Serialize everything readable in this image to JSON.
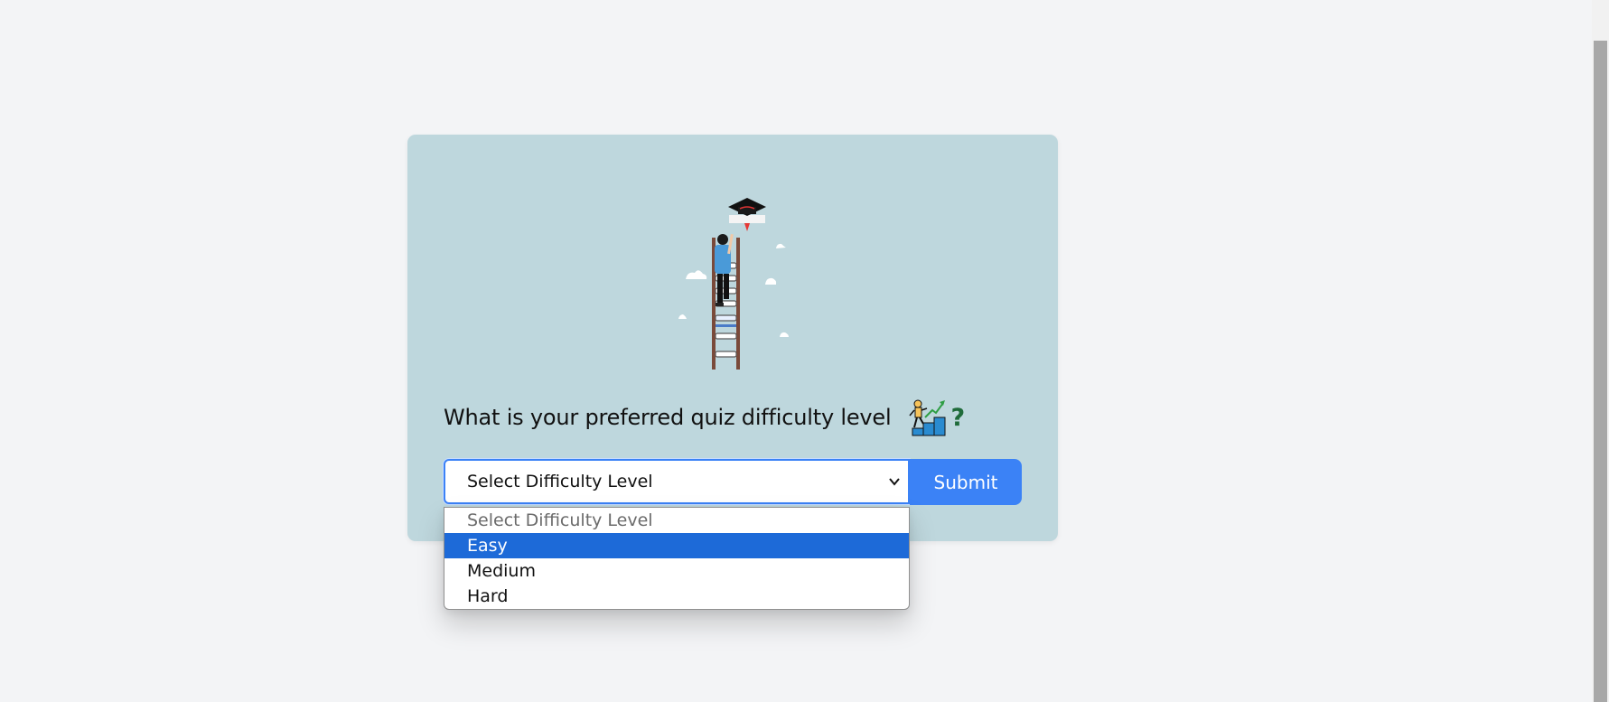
{
  "form": {
    "question": "What is your preferred quiz difficulty level",
    "question_mark": "?",
    "select": {
      "current_value": "Select Difficulty Level",
      "options": [
        {
          "label": "Select Difficulty Level",
          "state": "placeholder"
        },
        {
          "label": "Easy",
          "state": "highlighted"
        },
        {
          "label": "Medium",
          "state": "normal"
        },
        {
          "label": "Hard",
          "state": "normal"
        }
      ]
    },
    "submit_label": "Submit"
  },
  "icons": {
    "hero": "ladder-graduation-illustration",
    "question": "climbing-steps-growth-icon",
    "chevron": "chevron-down-icon"
  },
  "colors": {
    "page_background": "#f3f4f6",
    "card_background": "#bed7dd",
    "accent": "#3b82f6",
    "option_highlight": "#1d6ad8",
    "question_mark": "#1f6b3a"
  }
}
